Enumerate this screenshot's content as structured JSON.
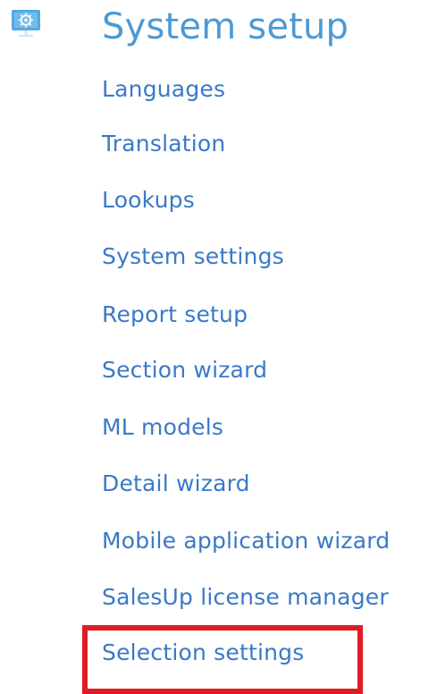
{
  "section": {
    "title": "System setup",
    "icon": "monitor-gear-icon",
    "items": [
      {
        "label": "Languages"
      },
      {
        "label": "Translation"
      },
      {
        "label": "Lookups"
      },
      {
        "label": "System settings"
      },
      {
        "label": "Report setup"
      },
      {
        "label": "Section wizard"
      },
      {
        "label": "ML models"
      },
      {
        "label": "Detail wizard"
      },
      {
        "label": "Mobile application wizard"
      },
      {
        "label": "SalesUp license manager"
      },
      {
        "label": "Selection settings"
      }
    ]
  },
  "highlight": {
    "target": "Selection settings",
    "color": "#e01b24"
  },
  "colors": {
    "title": "#4b9ad6",
    "link": "#3a79c8",
    "icon": "#52a9e3"
  }
}
